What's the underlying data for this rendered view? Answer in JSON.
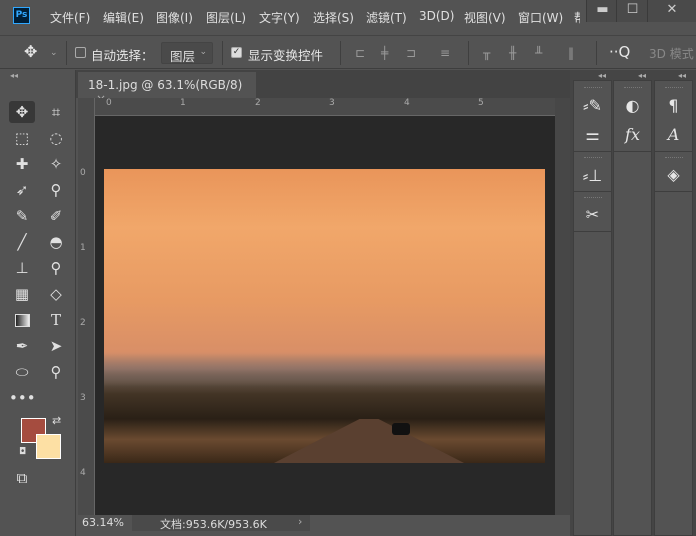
{
  "app": {
    "logo": "Ps"
  },
  "menu": [
    "文件(F)",
    "编辑(E)",
    "图像(I)",
    "图层(L)",
    "文字(Y)",
    "选择(S)",
    "滤镜(T)",
    "3D(D)",
    "视图(V)",
    "窗口(W)",
    "帮"
  ],
  "window_controls": {
    "minimize": "▬",
    "maximize": "☐",
    "close": "✕"
  },
  "options": {
    "auto_select_label": "自动选择：",
    "auto_select_checked": false,
    "layer_select": "图层",
    "show_transform_label": "显示变换控件",
    "show_transform_checked": true,
    "mode_3d": "3D 模式"
  },
  "document": {
    "tab_title": "18-1.jpg @ 63.1%(RGB/8)",
    "close": "×"
  },
  "rulers": {
    "h": [
      "0",
      "1",
      "2",
      "3",
      "4",
      "5"
    ],
    "v": [
      "0",
      "1",
      "2",
      "3",
      "4"
    ]
  },
  "status": {
    "zoom": "63.14%",
    "doc_info": "文档:953.6K/953.6K",
    "arrow": "›"
  },
  "colors": {
    "foreground": "#a54c3f",
    "background": "#fde0a4",
    "accent": "#31a8ff"
  },
  "tools": [
    "move-icon",
    "crop-icon",
    "marquee-icon",
    "lasso-icon",
    "healing-icon",
    "magic-eraser-icon",
    "pen-arrow-icon",
    "eyedropper-icon",
    "brush-icon",
    "history-brush-icon",
    "paintbrush-icon",
    "smudge-icon",
    "stamp-icon",
    "color-sampler-icon",
    "perspective-icon",
    "eraser-icon",
    "gradient-icon",
    "type-icon",
    "pen-icon",
    "path-select-icon",
    "ellipse-icon",
    "zoom-icon",
    "more-icon",
    "screen-mode-icon"
  ]
}
